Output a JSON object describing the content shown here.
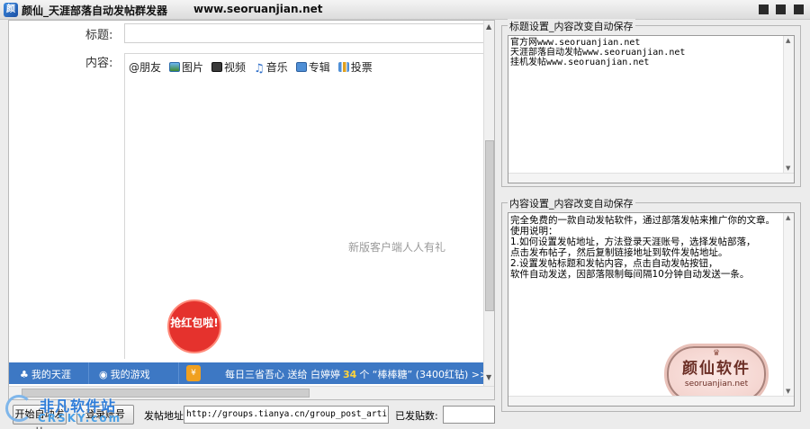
{
  "window": {
    "title": "颜仙_天涯部落自动发帖群发器",
    "url": "www.seoruanjian.net",
    "icon_letter": "颜",
    "controls": [
      "minimize-icon",
      "maximize-icon",
      "close-icon"
    ]
  },
  "web": {
    "title_label": "标题:",
    "content_label": "内容:",
    "title_value": "",
    "toolbar": {
      "friend": "@朋友",
      "image": "图片",
      "video": "视频",
      "music": "音乐",
      "album": "专辑",
      "vote": "投票"
    },
    "promo": "新版客户端人人有礼",
    "redpacket": "抢红包啦!",
    "bottom_bar": {
      "my_tianya": "我的天涯",
      "my_games": "我的游戏",
      "daily_prefix": "每日三省吾心 送给 白婷婷",
      "daily_number": "34",
      "daily_suffix": "个 “棒棒糖” (3400红钻)  >>"
    }
  },
  "right": {
    "title_group": {
      "caption": "标题设置_内容改变自动保存",
      "lines": [
        "官方网www.seoruanjian.net",
        "天涯部落自动发帖www.seoruanjian.net",
        "挂机发帖www.seoruanjian.net"
      ]
    },
    "content_group": {
      "caption": "内容设置_内容改变自动保存",
      "lines": [
        "完全免费的一款自动发帖软件，通过部落发帖来推广你的文章。",
        "",
        "使用说明：",
        "",
        "1.如何设置发帖地址，方法登录天涯账号，选择发帖部落，",
        "点击发布帖子，然后复制链接地址到软件发帖地址。",
        "",
        "",
        "2.设置发帖标题和发帖内容，点击自动发帖按钮，",
        "软件自动发送，因部落限制每间隔10分钟自动发送一条。"
      ],
      "stamp": {
        "name": "颜仙软件",
        "site": "seoruanjian.net"
      }
    }
  },
  "controls": {
    "start_button": "开始自动发帖",
    "login_button": "登录账号",
    "url_label": "发帖地址:",
    "url_value": "http://groups.tianya.cn/group_post_article.jsp",
    "posted_label": "已发贴数:",
    "posted_value": ""
  },
  "watermark": {
    "cn": "非凡软件站",
    "en": "CRSKY.com"
  }
}
